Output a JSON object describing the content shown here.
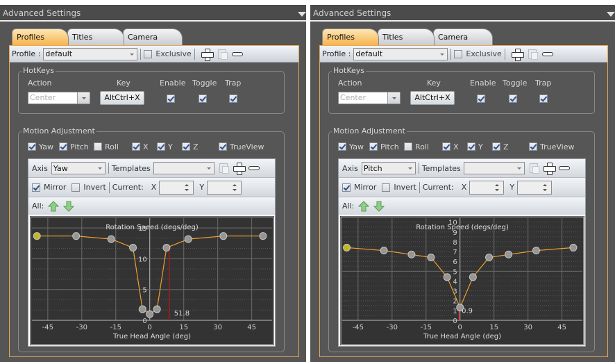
{
  "panels": [
    {
      "title": "Advanced Settings",
      "tabs": [
        {
          "label": "Profiles",
          "active": true
        },
        {
          "label": "Titles",
          "active": false
        },
        {
          "label": "Camera",
          "active": false
        }
      ],
      "profile": {
        "label": "Profile :",
        "value": "default",
        "exclusive_label": "Exclusive",
        "exclusive_checked": false
      },
      "hotkeys": {
        "legend": "HotKeys",
        "headers": {
          "action": "Action",
          "key": "Key",
          "enable": "Enable",
          "toggle": "Toggle",
          "trap": "Trap"
        },
        "action_value": "Center",
        "key_value": "AltCtrl+X",
        "enable": true,
        "toggle": true,
        "trap": true
      },
      "motion": {
        "legend": "Motion Adjustment",
        "checks": [
          {
            "label": "Yaw",
            "checked": true
          },
          {
            "label": "Pitch",
            "checked": true
          },
          {
            "label": "Roll",
            "checked": false
          },
          {
            "label": "X",
            "checked": true
          },
          {
            "label": "Y",
            "checked": true
          },
          {
            "label": "Z",
            "checked": true
          },
          {
            "label": "TrueView",
            "checked": true
          }
        ],
        "axis_label": "Axis",
        "axis_value": "Yaw",
        "templates_label": "Templates",
        "templates_value": "",
        "mirror_label": "Mirror",
        "mirror_checked": true,
        "invert_label": "Invert",
        "invert_checked": false,
        "current_label": "Current:",
        "x_label": "X",
        "y_label": "Y",
        "x_value": "",
        "y_value": "",
        "all_label": "All:"
      }
    },
    {
      "title": "Advanced Settings",
      "tabs": [
        {
          "label": "Profiles",
          "active": true
        },
        {
          "label": "Titles",
          "active": false
        },
        {
          "label": "Camera",
          "active": false
        }
      ],
      "profile": {
        "label": "Profile :",
        "value": "default",
        "exclusive_label": "Exclusive",
        "exclusive_checked": false
      },
      "hotkeys": {
        "legend": "HotKeys",
        "headers": {
          "action": "Action",
          "key": "Key",
          "enable": "Enable",
          "toggle": "Toggle",
          "trap": "Trap"
        },
        "action_value": "Center",
        "key_value": "AltCtrl+X",
        "enable": true,
        "toggle": true,
        "trap": true
      },
      "motion": {
        "legend": "Motion Adjustment",
        "checks": [
          {
            "label": "Yaw",
            "checked": true
          },
          {
            "label": "Pitch",
            "checked": true
          },
          {
            "label": "Roll",
            "checked": false
          },
          {
            "label": "X",
            "checked": true
          },
          {
            "label": "Y",
            "checked": true
          },
          {
            "label": "Z",
            "checked": true
          },
          {
            "label": "TrueView",
            "checked": true
          }
        ],
        "axis_label": "Axis",
        "axis_value": "Pitch",
        "templates_label": "Templates",
        "templates_value": "",
        "mirror_label": "Mirror",
        "mirror_checked": true,
        "invert_label": "Invert",
        "invert_checked": false,
        "current_label": "Current:",
        "x_label": "X",
        "y_label": "Y",
        "x_value": "",
        "y_value": "",
        "all_label": "All:"
      }
    }
  ],
  "colors": {
    "accent": "#f7b44e",
    "curve": "#f0a030",
    "marker": "#b01818",
    "point": "#9a9a9a",
    "selected_point": "#c8c020",
    "plot_bg": "#333333",
    "panel_bg": "#555555"
  },
  "chart_data": [
    {
      "type": "line",
      "title": "Rotation Speed (degs/deg)",
      "xlabel": "True Head Angle (deg)",
      "ylabel": "Rotation Speed (degs/deg)",
      "xlim": [
        -52,
        54
      ],
      "ylim": [
        0,
        16.6
      ],
      "xticks": [
        -45,
        -30,
        -15,
        0,
        15,
        30,
        45
      ],
      "yticks": [
        0,
        5,
        10,
        15
      ],
      "grid": true,
      "x": [
        -49.8,
        -32.5,
        -17,
        -7.4,
        -3.2,
        0,
        3.2,
        7.4,
        17,
        32.5,
        50
      ],
      "y": [
        13.7,
        13.7,
        13.2,
        11.8,
        1.8,
        1.0,
        1.8,
        11.8,
        13.2,
        13.7,
        13.7
      ],
      "selected_index": 0,
      "marker_x": 8.6,
      "marker_label": "51.8"
    },
    {
      "type": "line",
      "title": "Rotation Speed (degs/deg)",
      "xlabel": "True Head Angle (deg)",
      "ylabel": "Rotation Speed (degs/deg)",
      "xlim": [
        -52,
        54
      ],
      "ylim": [
        0,
        10.4
      ],
      "xticks": [
        -45,
        -30,
        -15,
        0,
        15,
        30,
        45
      ],
      "yticks": [
        0,
        1,
        2,
        3,
        4,
        5,
        6,
        7,
        8,
        9,
        10
      ],
      "grid": true,
      "x": [
        -50,
        -33.6,
        -21.4,
        -12.8,
        -5.7,
        0,
        5.7,
        12.8,
        21.4,
        33.6,
        50
      ],
      "y": [
        7.4,
        7.1,
        6.7,
        6.4,
        4.4,
        1.3,
        4.4,
        6.4,
        6.7,
        7.1,
        7.4
      ],
      "selected_index": 0,
      "marker_x": -0.5,
      "marker_label": "0.9"
    }
  ]
}
